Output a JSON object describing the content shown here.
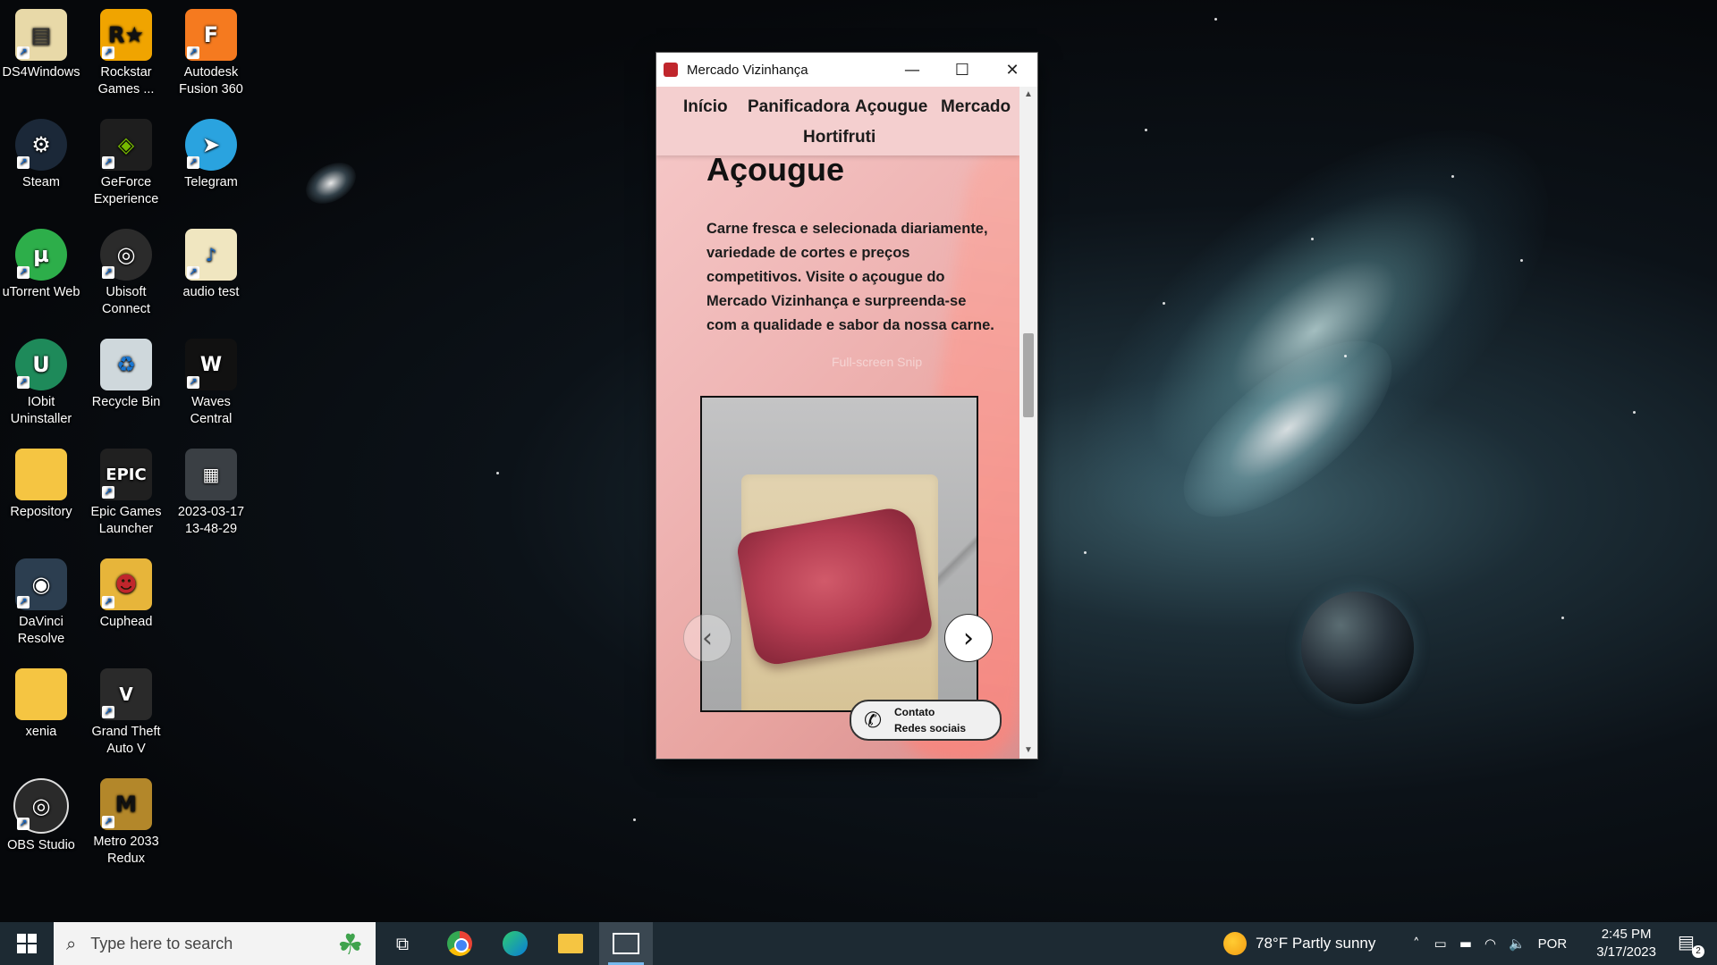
{
  "desktop": {
    "icons": [
      {
        "label": "DS4Windows",
        "name": "ds4windows-icon",
        "color": "#e8d9a8"
      },
      {
        "label": "Rockstar Games ...",
        "name": "rockstar-games-icon",
        "color": "#f0a400"
      },
      {
        "label": "Autodesk Fusion 360",
        "name": "autodesk-fusion-icon",
        "color": "#f57a1f"
      },
      {
        "label": "Steam",
        "name": "steam-icon",
        "color": "#1b2838"
      },
      {
        "label": "GeForce Experience",
        "name": "geforce-experience-icon",
        "color": "#1e1e1e"
      },
      {
        "label": "Telegram",
        "name": "telegram-icon",
        "color": "#2aa3df"
      },
      {
        "label": "uTorrent Web",
        "name": "utorrent-icon",
        "color": "#2dae4a"
      },
      {
        "label": "Ubisoft Connect",
        "name": "ubisoft-connect-icon",
        "color": "#2b2b2b"
      },
      {
        "label": "audio test",
        "name": "audio-test-file-icon",
        "color": "#f0e6c0"
      },
      {
        "label": "IObit Uninstaller",
        "name": "iobit-uninstaller-icon",
        "color": "#1e8a5a"
      },
      {
        "label": "Recycle Bin",
        "name": "recycle-bin-icon",
        "color": "#cfd8dc"
      },
      {
        "label": "Waves Central",
        "name": "waves-central-icon",
        "color": "#111111"
      },
      {
        "label": "Repository",
        "name": "repository-folder-icon",
        "color": "#f5c542"
      },
      {
        "label": "Epic Games Launcher",
        "name": "epic-games-icon",
        "color": "#202020"
      },
      {
        "label": "2023-03-17 13-48-29",
        "name": "video-file-icon",
        "color": "#3a3f44"
      },
      {
        "label": "DaVinci Resolve",
        "name": "davinci-resolve-icon",
        "color": "#2c3e50"
      },
      {
        "label": "Cuphead",
        "name": "cuphead-icon",
        "color": "#e7b53a"
      },
      {
        "label": "xenia",
        "name": "xenia-folder-icon",
        "color": "#f5c542"
      },
      {
        "label": "Grand Theft Auto V",
        "name": "gta-v-icon",
        "color": "#2a2a2a"
      },
      {
        "label": "OBS Studio",
        "name": "obs-studio-icon",
        "color": "#2a2a2a"
      },
      {
        "label": "Metro 2033 Redux",
        "name": "metro-2033-icon",
        "color": "#b3872a"
      }
    ]
  },
  "window": {
    "title": "Mercado Vizinhança",
    "minimize_glyph": "—",
    "maximize_glyph": "☐",
    "close_glyph": "✕"
  },
  "site": {
    "nav": {
      "inicio": "Início",
      "panificadora": "Panificadora",
      "acougue": "Açougue",
      "mercado": "Mercado",
      "hortifruti": "Hortifruti"
    },
    "section_title": "Açougue",
    "section_text": "Carne fresca e selecionada diariamente, variedade de cortes e preços competitivos. Visite o açougue do Mercado Vizinhança e surpreenda-se com a qualidade e sabor da nossa carne.",
    "ghost_text": "Full-screen Snip",
    "carousel": {
      "prev_glyph": "‹",
      "next_glyph": "›"
    },
    "contact": {
      "line1": "Contato",
      "line2": "Redes sociais"
    }
  },
  "taskbar": {
    "search_placeholder": "Type here to search",
    "weather": "78°F  Partly sunny",
    "language": "POR",
    "time": "2:45 PM",
    "date": "3/17/2023",
    "notification_count": "2"
  }
}
